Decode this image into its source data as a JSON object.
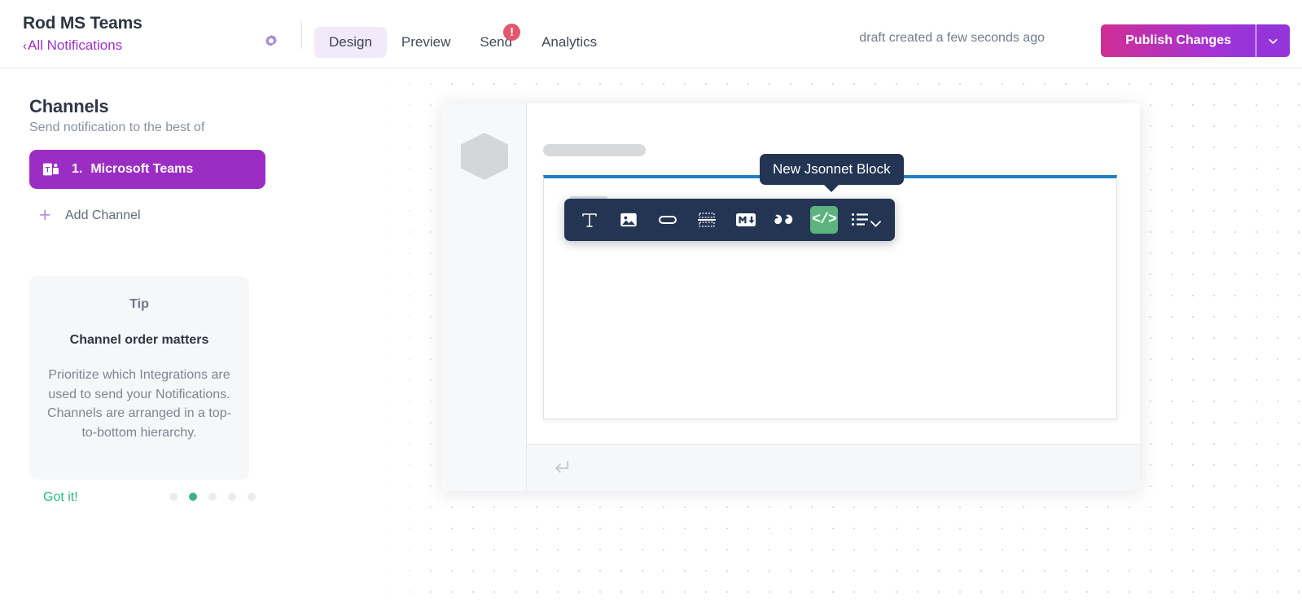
{
  "header": {
    "brand_title": "Rod MS Teams",
    "back_link": "All Notifications",
    "back_chevron": "‹",
    "gear_icon": "gear-icon",
    "tabs": [
      {
        "label": "Design",
        "active": true,
        "badge": null
      },
      {
        "label": "Preview",
        "active": false,
        "badge": null
      },
      {
        "label": "Send",
        "active": false,
        "badge": "!"
      },
      {
        "label": "Analytics",
        "active": false,
        "badge": null
      }
    ],
    "draft_status": "draft created a few seconds ago",
    "publish_label": "Publish Changes",
    "publish_caret_icon": "chevron-down-icon",
    "accent_purple": "#9434d9",
    "accent_magenta": "#cf2e93",
    "badge_color": "#e2566e"
  },
  "sidebar": {
    "heading": "Channels",
    "subheading": "Send notification to the best of",
    "channels": [
      {
        "index": "1.",
        "name": "Microsoft Teams",
        "icon": "microsoft-teams-icon"
      }
    ],
    "add_channel_label": "Add Channel",
    "add_channel_icon": "plus-icon",
    "tip": {
      "eyebrow": "Tip",
      "title": "Channel order matters",
      "body": "Prioritize which Integrations are used to send your Notifications. Channels are arranged in a top-to-bottom hierarchy.",
      "dismiss_label": "Got it!",
      "dots_total": 5,
      "dots_active_index": 1,
      "active_dot_color": "#3bb18c"
    }
  },
  "canvas": {
    "card": {
      "avatar_icon": "hexagon-avatar-placeholder",
      "title_placeholder": "title-placeholder-bar",
      "block": {
        "accent_color": "#1f7fc4",
        "drag_handle_icon": "drag-handle-icon"
      },
      "footer_icon": "reply-arrow-icon"
    }
  },
  "toolbar": {
    "tooltip_text": "New Jsonnet Block",
    "selected_color": "#5cb37e",
    "buttons": [
      {
        "name": "text-block-button",
        "icon": "text-T-icon",
        "label": "T",
        "selected": false
      },
      {
        "name": "image-block-button",
        "icon": "image-icon",
        "label": "",
        "selected": false
      },
      {
        "name": "button-block-button",
        "icon": "button-pill-icon",
        "label": "",
        "selected": false
      },
      {
        "name": "divider-block-button",
        "icon": "divider-icon",
        "label": "",
        "selected": false
      },
      {
        "name": "markdown-block-button",
        "icon": "markdown-icon",
        "label": "M",
        "selected": false
      },
      {
        "name": "quote-block-button",
        "icon": "quote-icon",
        "label": "“",
        "selected": false
      },
      {
        "name": "jsonnet-block-button",
        "icon": "code-icon",
        "label": "</>",
        "selected": true
      },
      {
        "name": "more-blocks-button",
        "icon": "list-chevron-icon",
        "label": "",
        "selected": false
      }
    ]
  }
}
